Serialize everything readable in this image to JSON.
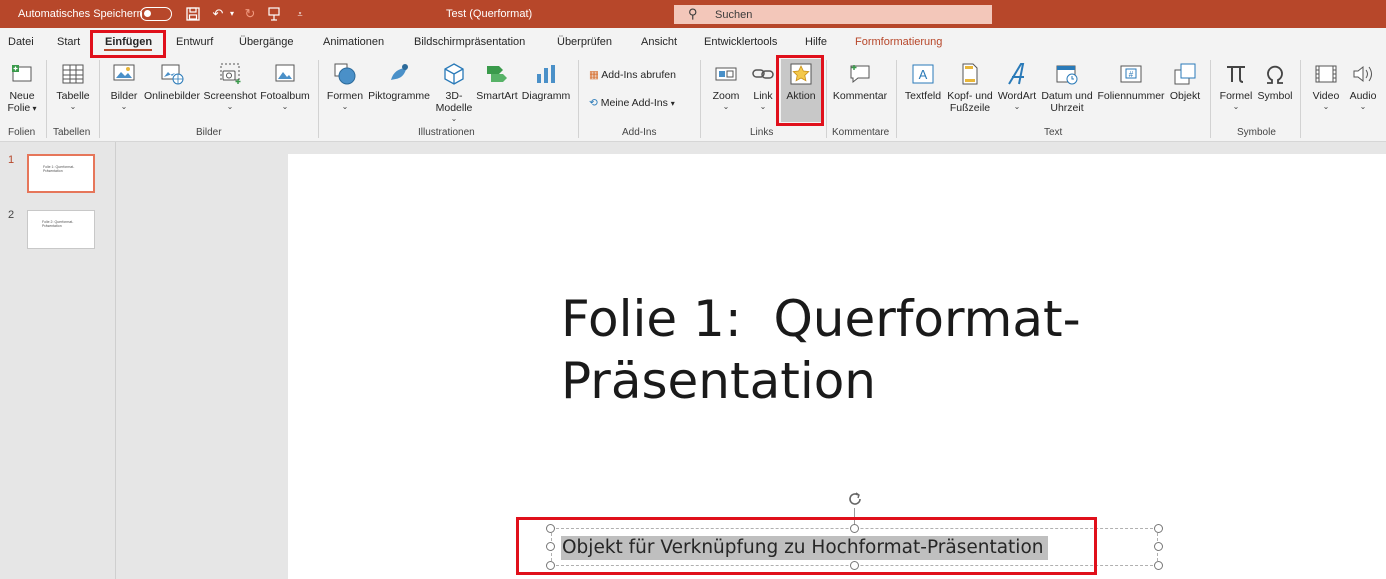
{
  "titlebar": {
    "autosave_label": "Automatisches Speichern",
    "document_title": "Test (Querformat)",
    "search_placeholder": "Suchen"
  },
  "tabs": [
    {
      "label": "Datei"
    },
    {
      "label": "Start"
    },
    {
      "label": "Einfügen",
      "active": true
    },
    {
      "label": "Entwurf"
    },
    {
      "label": "Übergänge"
    },
    {
      "label": "Animationen"
    },
    {
      "label": "Bildschirmpräsentation"
    },
    {
      "label": "Überprüfen"
    },
    {
      "label": "Ansicht"
    },
    {
      "label": "Entwicklertools"
    },
    {
      "label": "Hilfe"
    },
    {
      "label": "Formformatierung",
      "contextual": true
    }
  ],
  "ribbon": {
    "folien": {
      "group": "Folien",
      "neue_folie_1": "Neue",
      "neue_folie_2": "Folie"
    },
    "tabellen": {
      "group": "Tabellen",
      "tabelle": "Tabelle"
    },
    "bilder": {
      "group": "Bilder",
      "bilder": "Bilder",
      "onlinebilder": "Onlinebilder",
      "screenshot": "Screenshot",
      "fotoalbum": "Fotoalbum"
    },
    "illustrationen": {
      "group": "Illustrationen",
      "formen": "Formen",
      "piktogramme": "Piktogramme",
      "modelle_1": "3D-",
      "modelle_2": "Modelle",
      "smartart": "SmartArt",
      "diagramm": "Diagramm"
    },
    "addins": {
      "group": "Add-Ins",
      "abrufen": "Add-Ins abrufen",
      "meine": "Meine Add-Ins"
    },
    "links": {
      "group": "Links",
      "zoom": "Zoom",
      "link": "Link",
      "aktion": "Aktion"
    },
    "kommentare": {
      "group": "Kommentare",
      "kommentar": "Kommentar"
    },
    "text": {
      "group": "Text",
      "textfeld": "Textfeld",
      "kopf_1": "Kopf- und",
      "kopf_2": "Fußzeile",
      "wordart": "WordArt",
      "datum_1": "Datum und",
      "datum_2": "Uhrzeit",
      "foliennummer": "Foliennummer",
      "objekt": "Objekt"
    },
    "symbole": {
      "group": "Symbole",
      "formel": "Formel",
      "symbol": "Symbol"
    },
    "medien": {
      "video": "Video",
      "audio": "Audio"
    }
  },
  "slides_panel": {
    "slides": [
      {
        "number": "1",
        "thumb_line1": "Folie 1: Querformat-",
        "thumb_line2": "Präsentation"
      },
      {
        "number": "2",
        "thumb_line1": "Folie 2: Querformat-",
        "thumb_line2": "Präsentation"
      }
    ]
  },
  "slide": {
    "title_line1": "Folie 1:  Querformat-",
    "title_line2": "Präsentation",
    "subtitle": "Objekt für Verknüpfung zu Hochformat-Präsentation"
  },
  "colors": {
    "accent": "#b7472a",
    "highlight": "#e0101b",
    "ribbon_bg": "#f3f3f3"
  }
}
